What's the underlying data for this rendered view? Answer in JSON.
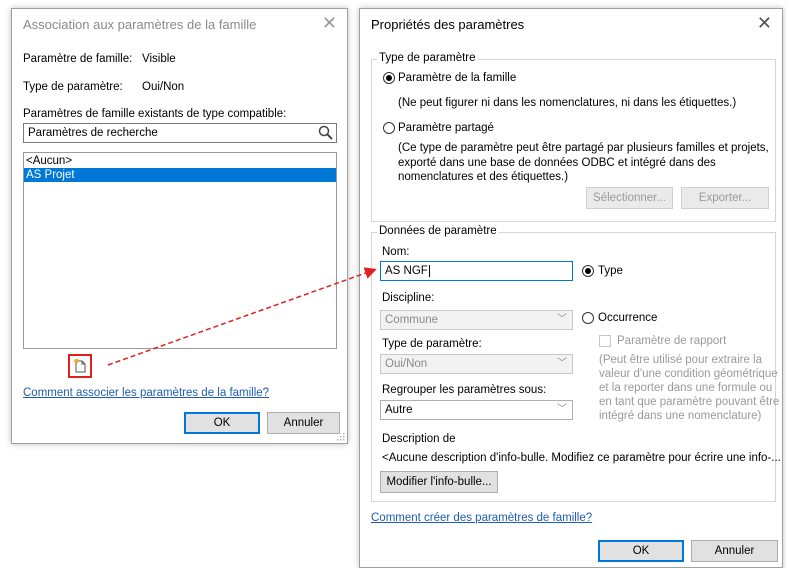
{
  "dialog1": {
    "title": "Association aux paramètres de la famille",
    "family_param_label": "Paramètre de famille:",
    "family_param_value": "Visible",
    "param_type_label": "Type de paramètre:",
    "param_type_value": "Oui/Non",
    "compatible_label": "Paramètres de famille existants de type compatible:",
    "search_placeholder": "Paramètres de recherche",
    "list_items": [
      "<Aucun>",
      "AS Projet"
    ],
    "selected_index": 1,
    "help_link": "Comment associer les paramètres de la famille?",
    "ok_label": "OK",
    "cancel_label": "Annuler"
  },
  "dialog2": {
    "title": "Propriétés des paramètres",
    "type_group_title": "Type de paramètre",
    "family_param_radio": "Paramètre de la famille",
    "family_param_desc": "(Ne peut figurer ni dans les nomenclatures, ni dans les étiquettes.)",
    "shared_param_radio": "Paramètre partagé",
    "shared_param_desc_1": "(Ce type de paramètre peut être partagé par plusieurs familles et projets,",
    "shared_param_desc_2": "exporté dans une base de données ODBC et intégré dans des",
    "shared_param_desc_3": "nomenclatures et des étiquettes.)",
    "select_button": "Sélectionner...",
    "export_button": "Exporter...",
    "data_group_title": "Données de paramètre",
    "name_label": "Nom:",
    "name_value": "AS NGF",
    "type_radio": "Type",
    "discipline_label": "Discipline:",
    "discipline_value": "Commune",
    "occurrence_radio": "Occurrence",
    "param_type_label": "Type de paramètre:",
    "param_type_value": "Oui/Non",
    "report_param_label": "Paramètre de rapport",
    "report_desc_1": "(Peut être utilisé pour extraire la",
    "report_desc_2": "valeur d'une condition géométrique",
    "report_desc_3": "et la reporter dans une formule ou",
    "report_desc_4": "en tant que paramètre pouvant être",
    "report_desc_5": "intégré dans une nomenclature)",
    "group_under_label": "Regrouper les paramètres sous:",
    "group_under_value": "Autre",
    "description_label": "Description de",
    "description_value": "<Aucune description d'info-bulle. Modifiez ce paramètre pour écrire une info-...",
    "edit_tooltip_button": "Modifier l'info-bulle...",
    "help_link": "Comment créer des paramètres de famille?",
    "ok_label": "OK",
    "cancel_label": "Annuler"
  },
  "colors": {
    "accent": "#0078d7",
    "selection": "#0078d7",
    "link": "#1f5cb4",
    "highlight_red": "#e02020"
  }
}
